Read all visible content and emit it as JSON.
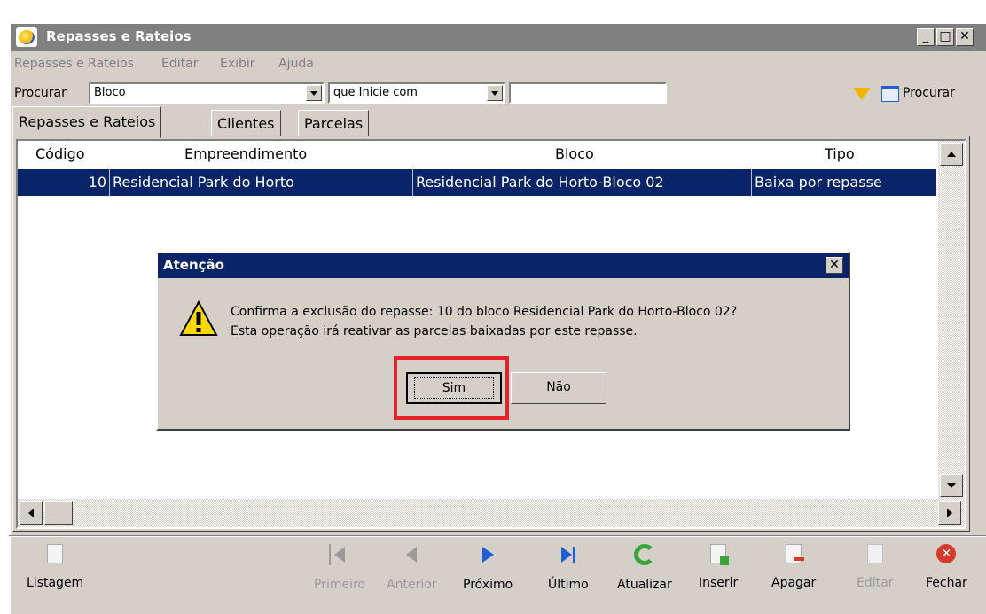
{
  "window": {
    "title": "Repasses e Rateios"
  },
  "menu": [
    {
      "label": "Repasses e Rateios"
    },
    {
      "label": "Editar"
    },
    {
      "label": "Exibir"
    },
    {
      "label": "Ajuda"
    }
  ],
  "search": {
    "label": "Procurar",
    "field_value": "Bloco",
    "condition_value": "que Inicie com",
    "text_value": "",
    "button_label": "Procurar"
  },
  "tabs": [
    {
      "label": "Repasses e Rateios",
      "active": true
    },
    {
      "label": "Clientes"
    },
    {
      "label": "Parcelas"
    }
  ],
  "grid": {
    "columns": [
      "Código",
      "Empreendimento",
      "Bloco",
      "Tipo"
    ],
    "rows": [
      {
        "codigo": "10",
        "empreendimento": "Residencial Park do Horto",
        "bloco": "Residencial Park do Horto-Bloco 02",
        "tipo": "Baixa por repasse"
      }
    ]
  },
  "dialog": {
    "title": "Atenção",
    "line1": "Confirma a exclusão do repasse: 10 do bloco Residencial Park do Horto-Bloco 02?",
    "line2": "Esta operação irá reativar as parcelas baixadas por este repasse.",
    "yes_label": "Sim",
    "no_label": "Não"
  },
  "toolbar": {
    "listagem": "Listagem",
    "primeiro": "Primeiro",
    "anterior": "Anterior",
    "proximo": "Próximo",
    "ultimo": "Último",
    "atualizar": "Atualizar",
    "inserir": "Inserir",
    "apagar": "Apagar",
    "editar": "Editar",
    "fechar": "Fechar"
  },
  "colors": {
    "selection": "#0a246a",
    "highlight": "#e5222a",
    "nav_blue": "#1f5fd6",
    "refresh_green": "#3aa43a",
    "close_red": "#d83a2a"
  }
}
